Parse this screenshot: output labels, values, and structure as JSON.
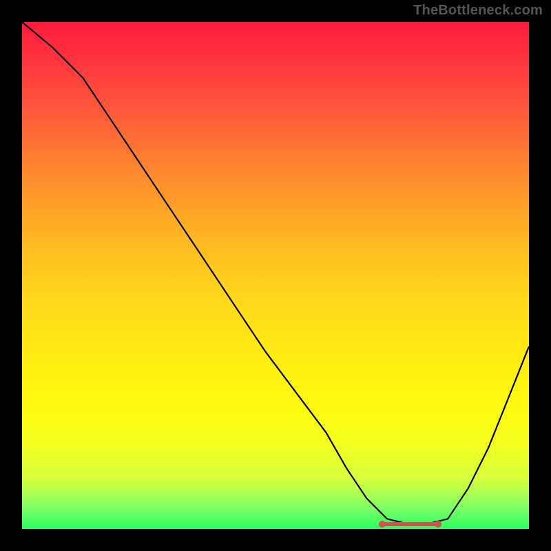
{
  "watermark": "TheBottleneck.com",
  "chart_data": {
    "type": "line",
    "title": "",
    "xlabel": "",
    "ylabel": "",
    "xlim": [
      0,
      100
    ],
    "ylim": [
      0,
      100
    ],
    "grid": false,
    "series": [
      {
        "name": "curve",
        "x": [
          0,
          6,
          12,
          18,
          24,
          30,
          36,
          42,
          48,
          54,
          60,
          64,
          68,
          72,
          76,
          80,
          84,
          88,
          92,
          96,
          100
        ],
        "values": [
          100,
          95,
          89,
          80,
          71,
          62,
          53,
          44,
          35,
          27,
          19,
          12,
          6,
          2,
          1,
          1,
          2,
          8,
          16,
          26,
          36
        ],
        "stroke": "#000000"
      },
      {
        "name": "highlight-flat-segment",
        "x": [
          71,
          82
        ],
        "values": [
          1,
          1
        ],
        "stroke": "#c9554d"
      }
    ],
    "background_gradient": {
      "top": "#ff1a3c",
      "mid": "#ffe914",
      "bottom": "#2aff5e"
    }
  }
}
